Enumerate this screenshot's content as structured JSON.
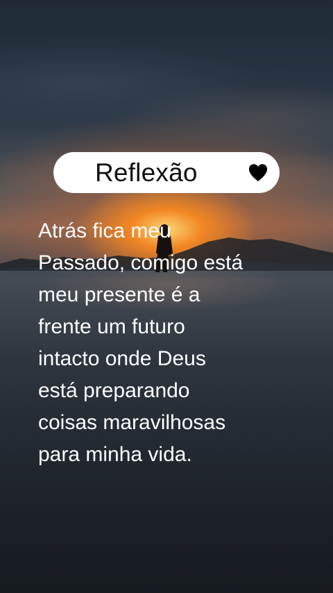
{
  "title_card": {
    "title": "Reflexão",
    "icon": "heart-icon"
  },
  "quote": {
    "lines": [
      "Atrás fica meu",
      "Passado, comigo está",
      "meu presente é a",
      "frente um futuro",
      "intacto onde Deus",
      "está preparando",
      "coisas maravilhosas",
      "para minha vida."
    ]
  },
  "colors": {
    "pill_background": "#ffffff",
    "title_text": "#111111",
    "quote_text": "#ffffff",
    "sun": "#ff9a2a"
  }
}
